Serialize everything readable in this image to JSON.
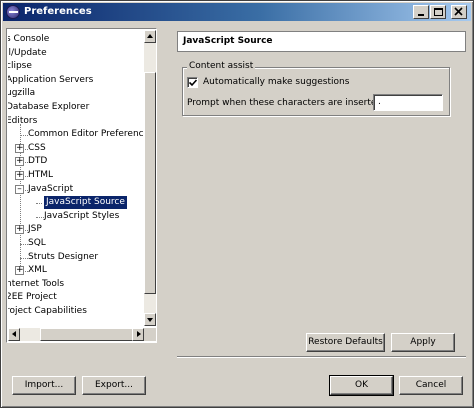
{
  "window": {
    "title": "Preferences"
  },
  "tree": {
    "items": [
      {
        "label": "s Console",
        "level": 0,
        "expander": ""
      },
      {
        "label": "ll/Update",
        "level": 0,
        "expander": ""
      },
      {
        "label": "clipse",
        "level": 0,
        "expander": ""
      },
      {
        "label": "Application Servers",
        "level": 0,
        "expander": ""
      },
      {
        "label": "ugzilla",
        "level": 0,
        "expander": ""
      },
      {
        "label": "Database Explorer",
        "level": 0,
        "expander": ""
      },
      {
        "label": "Editors",
        "level": 0,
        "expander": ""
      },
      {
        "label": "Common Editor Preferences",
        "level": 1,
        "expander": ""
      },
      {
        "label": "CSS",
        "level": 1,
        "expander": "+"
      },
      {
        "label": "DTD",
        "level": 1,
        "expander": "+"
      },
      {
        "label": "HTML",
        "level": 1,
        "expander": "+"
      },
      {
        "label": "JavaScript",
        "level": 1,
        "expander": "-"
      },
      {
        "label": "JavaScript Source",
        "level": 2,
        "expander": "",
        "selected": true
      },
      {
        "label": "JavaScript Styles",
        "level": 2,
        "expander": ""
      },
      {
        "label": "JSP",
        "level": 1,
        "expander": "+"
      },
      {
        "label": "SQL",
        "level": 1,
        "expander": ""
      },
      {
        "label": "Struts Designer",
        "level": 1,
        "expander": ""
      },
      {
        "label": "XML",
        "level": 1,
        "expander": "+"
      },
      {
        "label": "nternet Tools",
        "level": 0,
        "expander": ""
      },
      {
        "label": "2EE Project",
        "level": 0,
        "expander": ""
      },
      {
        "label": "roject Capabilities",
        "level": 0,
        "expander": ""
      }
    ]
  },
  "page": {
    "title": "JavaScript Source",
    "group_label": "Content assist",
    "auto_suggest_label": "Automatically make suggestions",
    "auto_suggest_checked": true,
    "prompt_label": "Prompt when these characters are inserted:",
    "prompt_value": "."
  },
  "buttons": {
    "restore_defaults": "Restore Defaults",
    "apply": "Apply",
    "import": "Import...",
    "export": "Export...",
    "ok": "OK",
    "cancel": "Cancel"
  },
  "colors": {
    "titlebar_start": "#0a246a",
    "titlebar_end": "#a6caf0",
    "selection": "#0a246a",
    "face": "#d4d0c8"
  }
}
